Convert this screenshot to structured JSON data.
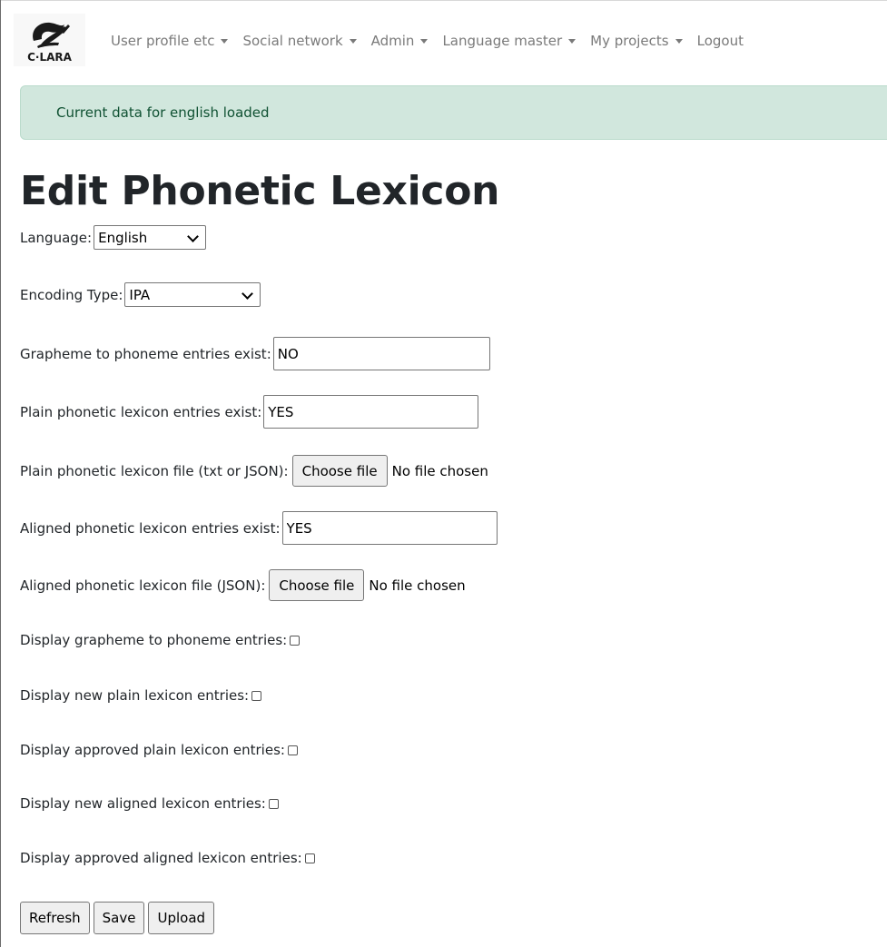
{
  "logo": {
    "text": "C·LARA"
  },
  "nav": {
    "items": [
      {
        "label": "User profile etc",
        "dropdown": true
      },
      {
        "label": "Social network",
        "dropdown": true
      },
      {
        "label": "Admin",
        "dropdown": true
      },
      {
        "label": "Language master",
        "dropdown": true
      },
      {
        "label": "My projects",
        "dropdown": true
      },
      {
        "label": "Logout",
        "dropdown": false
      }
    ]
  },
  "alert": {
    "message": "Current data for english loaded",
    "color": "#d1e7dd"
  },
  "page": {
    "title": "Edit Phonetic Lexicon"
  },
  "form": {
    "language_label": "Language:",
    "language_value": "English",
    "encoding_label": "Encoding Type:",
    "encoding_value": "IPA",
    "g2p_label": "Grapheme to phoneme entries exist:",
    "g2p_value": "NO",
    "plain_exist_label": "Plain phonetic lexicon entries exist:",
    "plain_exist_value": "YES",
    "plain_file_label": "Plain phonetic lexicon file (txt or JSON):",
    "aligned_exist_label": "Aligned phonetic lexicon entries exist:",
    "aligned_exist_value": "YES",
    "aligned_file_label": "Aligned phonetic lexicon file (JSON):",
    "choose_file": "Choose file",
    "no_file": "No file chosen",
    "display_g2p_label": "Display grapheme to phoneme entries:",
    "display_new_plain_label": "Display new plain lexicon entries:",
    "display_approved_plain_label": "Display approved plain lexicon entries:",
    "display_new_aligned_label": "Display new aligned lexicon entries:",
    "display_approved_aligned_label": "Display approved aligned lexicon entries:"
  },
  "buttons": {
    "refresh": "Refresh",
    "save": "Save",
    "upload": "Upload"
  }
}
